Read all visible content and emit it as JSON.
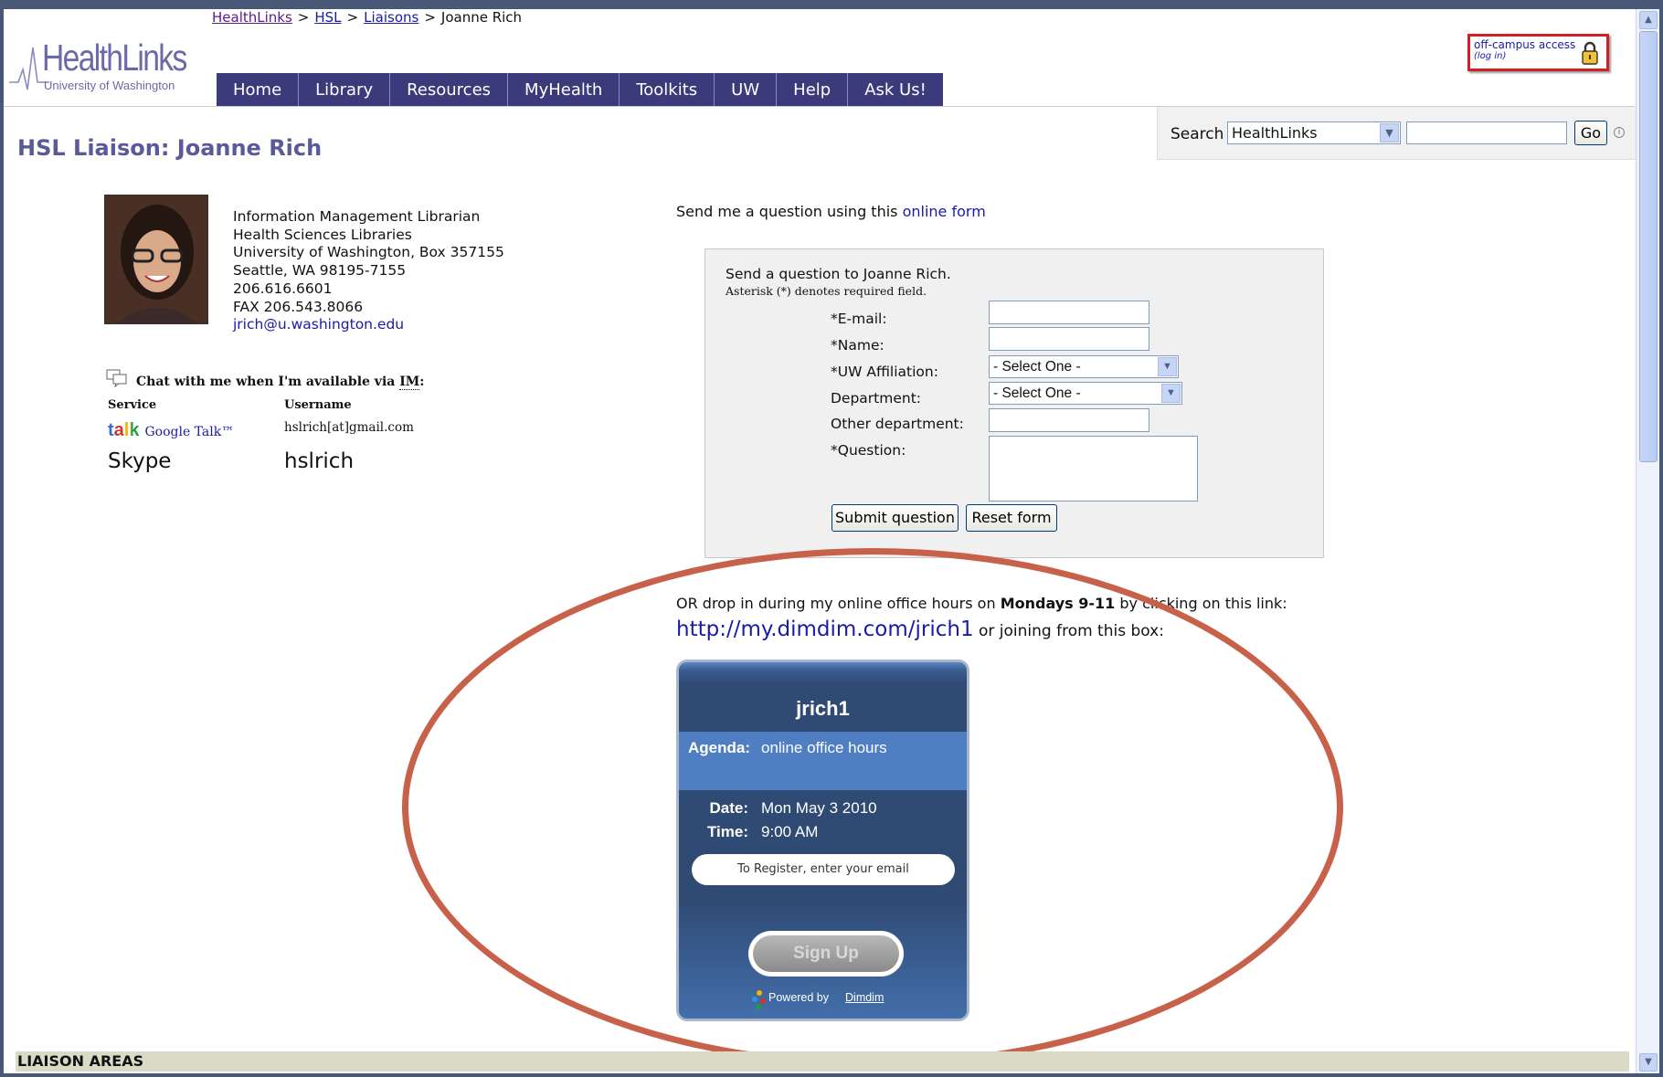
{
  "breadcrumb": {
    "items": [
      "HealthLinks",
      "HSL",
      "Liaisons"
    ],
    "current": "Joanne Rich",
    "separator": ">"
  },
  "logo": {
    "word": "HealthLinks",
    "subtitle": "University of Washington"
  },
  "nav": [
    "Home",
    "Library",
    "Resources",
    "MyHealth",
    "Toolkits",
    "UW",
    "Help",
    "Ask Us!"
  ],
  "offcampus": {
    "line1": "off-campus access",
    "line2": "(log in)"
  },
  "search": {
    "label": "Search",
    "scope": "HealthLinks",
    "go": "Go",
    "info": "i"
  },
  "page_title": "HSL Liaison: Joanne Rich",
  "profile": {
    "lines": [
      "Information Management Librarian",
      "Health Sciences Libraries",
      "University of Washington, Box 357155",
      "Seattle, WA 98195-7155",
      "206.616.6601",
      "FAX 206.543.8066"
    ],
    "email": "jrich@u.washington.edu"
  },
  "im": {
    "title_prefix": "Chat with me when I'm available via ",
    "title_abbr": "IM",
    "title_suffix": ":",
    "col_service": "Service",
    "col_username": "Username",
    "gtalk_logo": "talk",
    "gtalk_name": "Google Talk™",
    "gtalk_user": "hslrich[at]gmail.com",
    "skype_service": "Skype",
    "skype_user": "hslrich"
  },
  "form": {
    "intro_prefix": "Send me a question using this ",
    "intro_link": "online form",
    "heading": "Send a question to Joanne Rich.",
    "note": "Asterisk (*) denotes required field.",
    "labels": {
      "email": "*E-mail:",
      "name": "*Name:",
      "affiliation": "*UW Affiliation:",
      "department": "Department:",
      "other": "Other department:",
      "question": "*Question:"
    },
    "affiliation_value": "- Select One -",
    "department_value": "- Select One -",
    "submit": "Submit question",
    "reset": "Reset form"
  },
  "office_hours": {
    "line1_prefix": "OR drop in during my online office hours on ",
    "line1_bold": "Mondays 9-11",
    "line1_suffix": " by clicking on this link:",
    "url": "http://my.dimdim.com/jrich1",
    "line2_suffix": " or joining from this box:"
  },
  "widget": {
    "name": "jrich1",
    "agenda_label": "Agenda:",
    "agenda_value": "online office hours",
    "date_label": "Date:",
    "date_value": "Mon May 3 2010",
    "time_label": "Time:",
    "time_value": "9:00 AM",
    "register_placeholder": "To Register, enter your email",
    "signup": "Sign Up",
    "powered_by": "Powered by",
    "powered_link": "Dimdim"
  },
  "liaison_areas": "LIAISON AREAS",
  "colors": {
    "nav_bg": "#3b3a7a",
    "title": "#5a5a9a",
    "link": "#1a1aa6",
    "annotation": "#c8614a",
    "widget_dark": "#2f4a73",
    "widget_band": "#4f7fc2"
  }
}
